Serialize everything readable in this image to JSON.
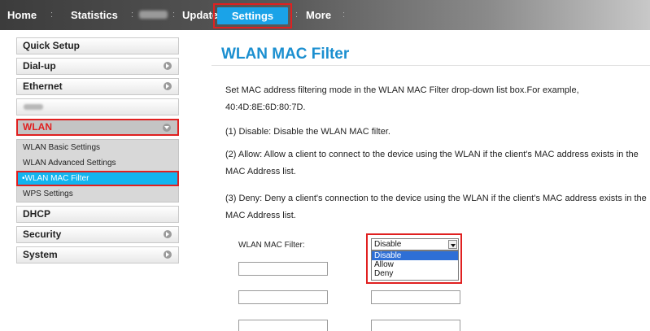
{
  "topnav": {
    "home": "Home",
    "statistics": "Statistics",
    "update": "Update",
    "settings": "Settings",
    "more": "More",
    "separator": ":"
  },
  "sidebar": {
    "quick_setup": "Quick Setup",
    "dialup": "Dial-up",
    "ethernet": "Ethernet",
    "wlan": "WLAN",
    "wlan_sub": [
      "WLAN Basic Settings",
      "WLAN Advanced Settings",
      "•WLAN MAC Filter",
      "WPS Settings"
    ],
    "dhcp": "DHCP",
    "security": "Security",
    "system": "System"
  },
  "content": {
    "title": "WLAN MAC Filter",
    "intro": "Set MAC address filtering mode in the WLAN MAC Filter drop-down list box.For example, 40:4D:8E:6D:80:7D.",
    "item1": "(1) Disable: Disable the WLAN MAC filter.",
    "item2": "(2) Allow: Allow a client to connect to the device using the WLAN if the client's MAC address exists in the MAC Address list.",
    "item3": "(3) Deny: Deny a client's connection to the device using the WLAN if the client's MAC address exists in the MAC Address list.",
    "filter_label": "WLAN MAC Filter:",
    "select_value": "Disable",
    "options": [
      "Disable",
      "Allow",
      "Deny"
    ]
  },
  "colors": {
    "accent": "#1aa3e8",
    "highlight_border": "#e02020",
    "title": "#1b8fd0"
  }
}
